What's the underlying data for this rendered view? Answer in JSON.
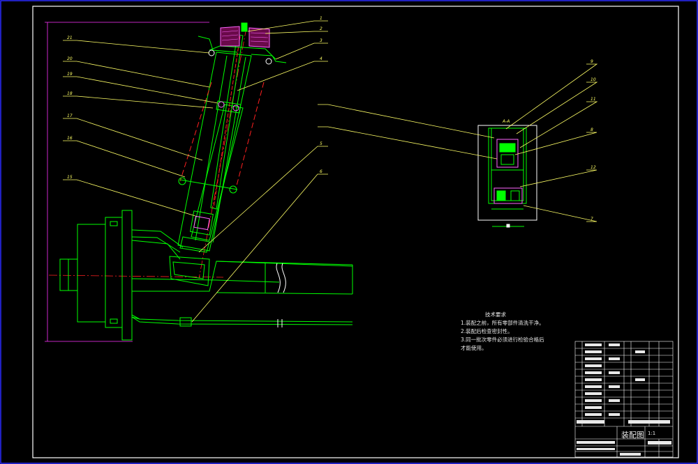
{
  "drawing": {
    "section_label": "A-A",
    "callouts_main": [
      "21",
      "20",
      "19",
      "18",
      "17",
      "16",
      "15",
      "1",
      "2",
      "3",
      "4",
      "5",
      "6"
    ],
    "callouts_detail": [
      "9",
      "10",
      "11",
      "8",
      "12",
      "7"
    ],
    "dimension_label": "",
    "technical_notes": {
      "title": "技术要求",
      "lines": [
        "1.装配之前，所有零部件清洗干净。",
        "2.装配后检查密封性。",
        "3.同一批次零件必须进行检验合格后才能使用。"
      ]
    },
    "title_block": {
      "drawing_name": "装配图",
      "school": "",
      "scale": "1:1"
    }
  },
  "colors": {
    "frame": "#2a2aff",
    "outline": "#00ff00",
    "leader": "#ffff66",
    "centerline": "#ff2020",
    "dimension": "#ff33ff",
    "hatch": "#ff66ff",
    "text": "#e8e8e8",
    "rubber_fill": "#6a0a4a"
  }
}
